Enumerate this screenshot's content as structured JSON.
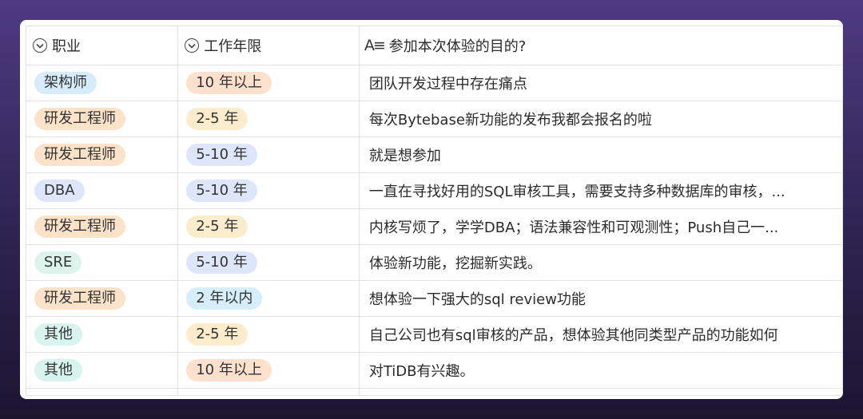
{
  "columns": [
    {
      "label": "职业",
      "icon": "dropdown-icon"
    },
    {
      "label": "工作年限",
      "icon": "dropdown-icon"
    },
    {
      "label": "参加本次体验的目的?",
      "icon": "text-type-icon"
    }
  ],
  "rows": [
    {
      "role": "架构师",
      "years": "10 年以上",
      "purpose": "团队开发过程中存在痛点"
    },
    {
      "role": "研发工程师",
      "years": "2-5 年",
      "purpose": "每次Bytebase新功能的发布我都会报名的啦"
    },
    {
      "role": "研发工程师",
      "years": "5-10 年",
      "purpose": "就是想参加"
    },
    {
      "role": "DBA",
      "years": "5-10 年",
      "purpose": "一直在寻找好用的SQL审核工具，需要支持多种数据库的审核，..."
    },
    {
      "role": "研发工程师",
      "years": "2-5 年",
      "purpose": "内核写烦了，学学DBA；语法兼容性和可观测性；Push自己一..."
    },
    {
      "role": "SRE",
      "years": "5-10 年",
      "purpose": "体验新功能，挖掘新实践。"
    },
    {
      "role": "研发工程师",
      "years": "2 年以内",
      "purpose": "想体验一下强大的sql review功能"
    },
    {
      "role": "其他",
      "years": "2-5 年",
      "purpose": "自己公司也有sql审核的产品，想体验其他同类型产品的功能如何"
    },
    {
      "role": "其他",
      "years": "10 年以上",
      "purpose": "对TiDB有兴趣。"
    }
  ],
  "colors": {
    "role": {
      "架构师": "#d7ecfb",
      "研发工程师": "#fbe2c8",
      "DBA": "#dde6fb",
      "SRE": "#ddf4ec",
      "其他": "#d9f4ec"
    },
    "years": {
      "10 年以上": "#fde1cd",
      "2-5 年": "#fbeccb",
      "5-10 年": "#dee6fb",
      "2 年以内": "#d6eefa"
    }
  }
}
